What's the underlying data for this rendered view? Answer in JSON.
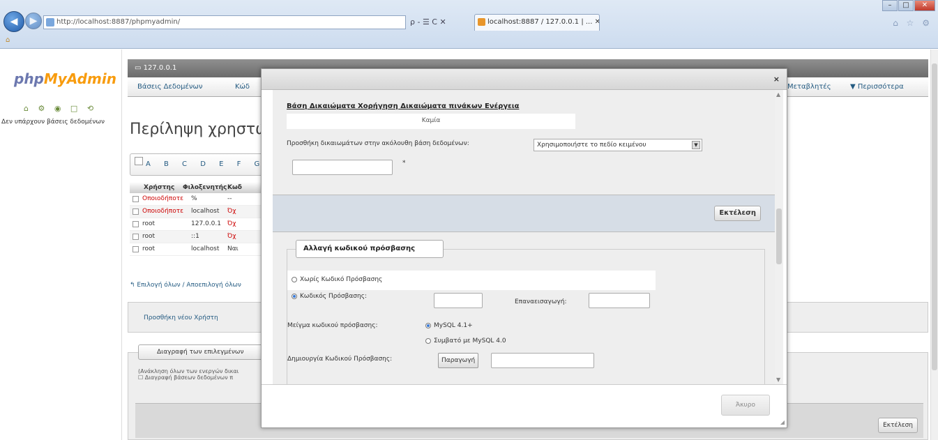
{
  "browser": {
    "address": "http://localhost:8887/phpmyadmin/",
    "address_tools": "ρ - ☰ C ✕",
    "tab_title": "localhost:8887 / 127.0.0.1 | ... ✕",
    "back_glyph": "◀",
    "fwd_glyph": "▶",
    "home_glyph": "⌂",
    "toolbar_glyphs": "⌂ ☆ ⚙",
    "win_min": "–",
    "win_max": "□",
    "win_close": "✕"
  },
  "left": {
    "logo_part1": "php",
    "logo_part2": "MyAdmin",
    "icons": "⌂ ⚙ ◉ □ ⟲",
    "no_db": "Δεν υπάρχουν βάσεις δεδομένων"
  },
  "main": {
    "server": "127.0.0.1",
    "menu": {
      "databases": "Βάσεις Δεδομένων",
      "sql": "Κώδ",
      "variables": "Μεταβλητές",
      "more": "▼ Περισσότερα"
    },
    "page_title": "Περίληψη χρηστών",
    "alpha_letters": "A B C D E F G H",
    "users_table": {
      "headers": [
        "Χρήστης",
        "Φιλοξενητής",
        "Κωδ"
      ],
      "rows": [
        {
          "user": "Οποιοδήποτε",
          "host": "%",
          "pw": "--",
          "red": true
        },
        {
          "user": "Οποιοδήποτε",
          "host": "localhost",
          "pw": "Όχ",
          "red": true
        },
        {
          "user": "root",
          "host": "127.0.0.1",
          "pw": "Όχ",
          "red": false
        },
        {
          "user": "root",
          "host": "::1",
          "pw": "Όχ",
          "red": false
        },
        {
          "user": "root",
          "host": "localhost",
          "pw": "Ναι",
          "red": false
        }
      ]
    },
    "check_all": "Επιλογή όλων / Αποεπιλογή όλων",
    "add_user": "Προσθήκη νέου Χρήστη",
    "delete_users_legend": "Διαγραφή των επιλεγμένων",
    "delete_users_text1": "(Ανάκληση όλων των ενεργών δικαι",
    "delete_users_text2": "Διαγραφή βάσεων δεδομένων π",
    "execute": "Εκτέλεση"
  },
  "dialog": {
    "close_x": "×",
    "db_table_header": "Βάση  Δικαιώματα  Χορήγηση  Δικαιώματα πινάκων  Ενέργεια",
    "db_table_none": "Καμία",
    "add_privs_label": "Προσθήκη δικαιωμάτων στην ακόλουθη βάση δεδομένων:",
    "db_select_value": "Χρησιμοποιήστε το πεδίο κειμένου",
    "star": "*",
    "execute": "Εκτέλεση",
    "pw_legend": "Αλλαγή κωδικού πρόσβασης",
    "no_password": "Χωρίς Κωδικό Πρόσβασης",
    "password": "Κωδικός Πρόσβασης:",
    "retype": "Επαναεισαγωγή:",
    "hashing": "Μείγμα κωδικού πρόσβασης:",
    "mysql41": "MySQL 4.1+",
    "mysql40": "Συμβατό με MySQL 4.0",
    "generate_label": "Δημιουργία Κωδικού Πρόσβασης:",
    "generate_btn": "Παραγωγή",
    "close_btn": "Άκυρο"
  }
}
